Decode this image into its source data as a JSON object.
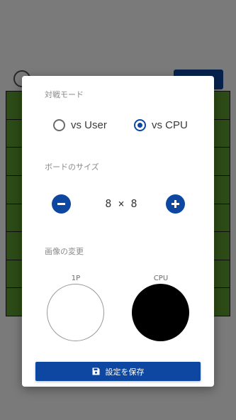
{
  "background": {
    "board_rows": 8,
    "board_cols": 8,
    "board_color": "#5c9e2f",
    "button_color": "#0d47a1"
  },
  "dialog": {
    "mode_section": {
      "title": "対戦モード",
      "options": [
        {
          "label": "vs User",
          "selected": false
        },
        {
          "label": "vs CPU",
          "selected": true
        }
      ]
    },
    "size_section": {
      "title": "ボードのサイズ",
      "value": "8 × 8",
      "decrease_icon": "minus-circle-icon",
      "increase_icon": "plus-circle-icon"
    },
    "image_section": {
      "title": "画像の変更",
      "players": [
        {
          "label": "1P",
          "color": "#ffffff"
        },
        {
          "label": "CPU",
          "color": "#000000"
        }
      ]
    },
    "save_button": {
      "label": "設定を保存",
      "icon": "save-icon"
    }
  },
  "colors": {
    "accent": "#0d47a1",
    "dim_overlay": "rgba(0,0,0,0.52)"
  }
}
